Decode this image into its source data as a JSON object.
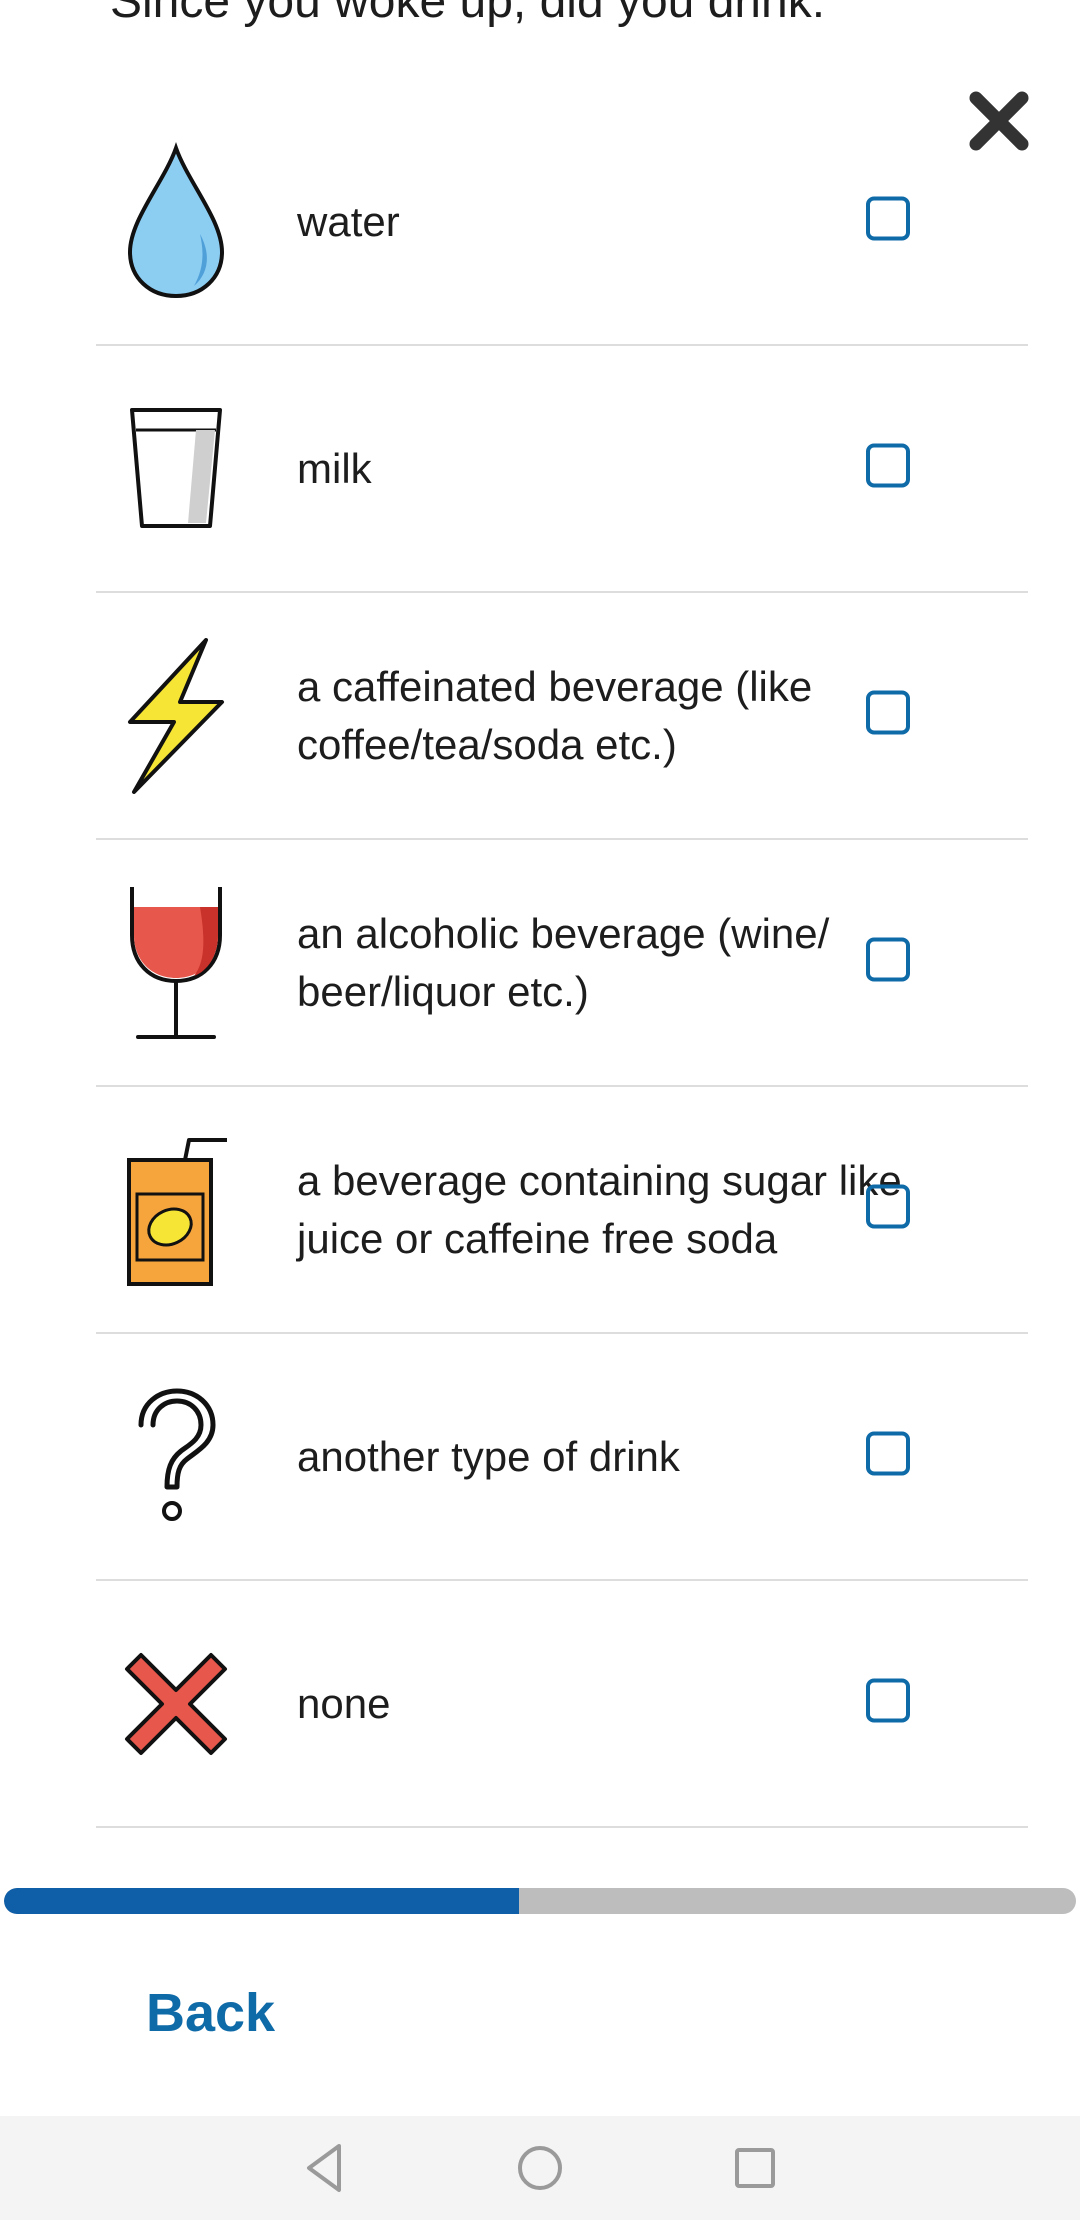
{
  "question": {
    "title": "Since you woke up, did you drink:"
  },
  "options": [
    {
      "label": "water",
      "icon": "water-drop-icon",
      "checked": false
    },
    {
      "label": "milk",
      "icon": "milk-glass-icon",
      "checked": false
    },
    {
      "label": "a caffeinated beverage (like coffee/tea/soda etc.)",
      "icon": "lightning-bolt-icon",
      "checked": false
    },
    {
      "label": "an alcoholic beverage (wine/ beer/liquor etc.)",
      "icon": "wine-glass-icon",
      "checked": false
    },
    {
      "label": "a beverage containing sugar like juice or caffeine free soda",
      "icon": "juice-box-icon",
      "checked": false
    },
    {
      "label": "another type of drink",
      "icon": "question-mark-icon",
      "checked": false
    },
    {
      "label": "none",
      "icon": "red-x-icon",
      "checked": false
    }
  ],
  "progress": {
    "fraction": 0.48
  },
  "footer": {
    "back_label": "Back"
  },
  "colors": {
    "accent": "#0f6aa8",
    "progress_fill": "#0f5ea8",
    "progress_track": "#bdbdbd",
    "divider": "#dddddd"
  }
}
